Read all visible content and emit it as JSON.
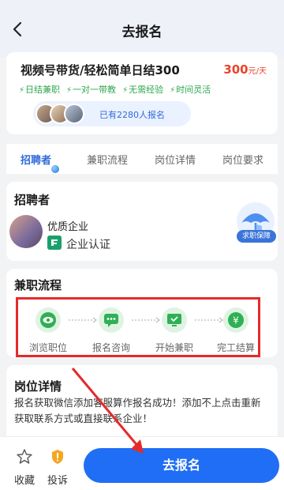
{
  "header": {
    "title": "去报名",
    "back_icon": "chevron-left-icon"
  },
  "job": {
    "title": "视频号带货/轻松简单日结300",
    "salary_amount": "300",
    "salary_unit": "元/天",
    "tags": [
      "日结兼职",
      "一对一带教",
      "无需经验",
      "时间灵活"
    ],
    "applied_text": "已有2280人报名"
  },
  "tabs": [
    "招聘者",
    "兼职流程",
    "岗位详情",
    "岗位要求"
  ],
  "recruiter": {
    "section_title": "招聘者",
    "name": "优质企业",
    "verification": "企业认证",
    "guarantee_label": "求职保障"
  },
  "process": {
    "section_title": "兼职流程",
    "steps": [
      {
        "label": "浏览职位",
        "icon": "eye-icon"
      },
      {
        "label": "报名咨询",
        "icon": "chat-icon"
      },
      {
        "label": "开始兼职",
        "icon": "monitor-icon"
      },
      {
        "label": "完工结算",
        "icon": "yen-icon"
      }
    ]
  },
  "details": {
    "section_title": "岗位详情",
    "text": "报名获取微信添加客服算作报名成功！添加不上点击重新获取联系方式或直接联系企业！"
  },
  "bottom": {
    "favorite_label": "收藏",
    "complaint_label": "投诉",
    "apply_label": "去报名"
  },
  "colors": {
    "accent": "#1f6ef5",
    "salary": "#e8442a",
    "tag_green": "#2fa84f",
    "annotation_red": "#e52a2a"
  }
}
